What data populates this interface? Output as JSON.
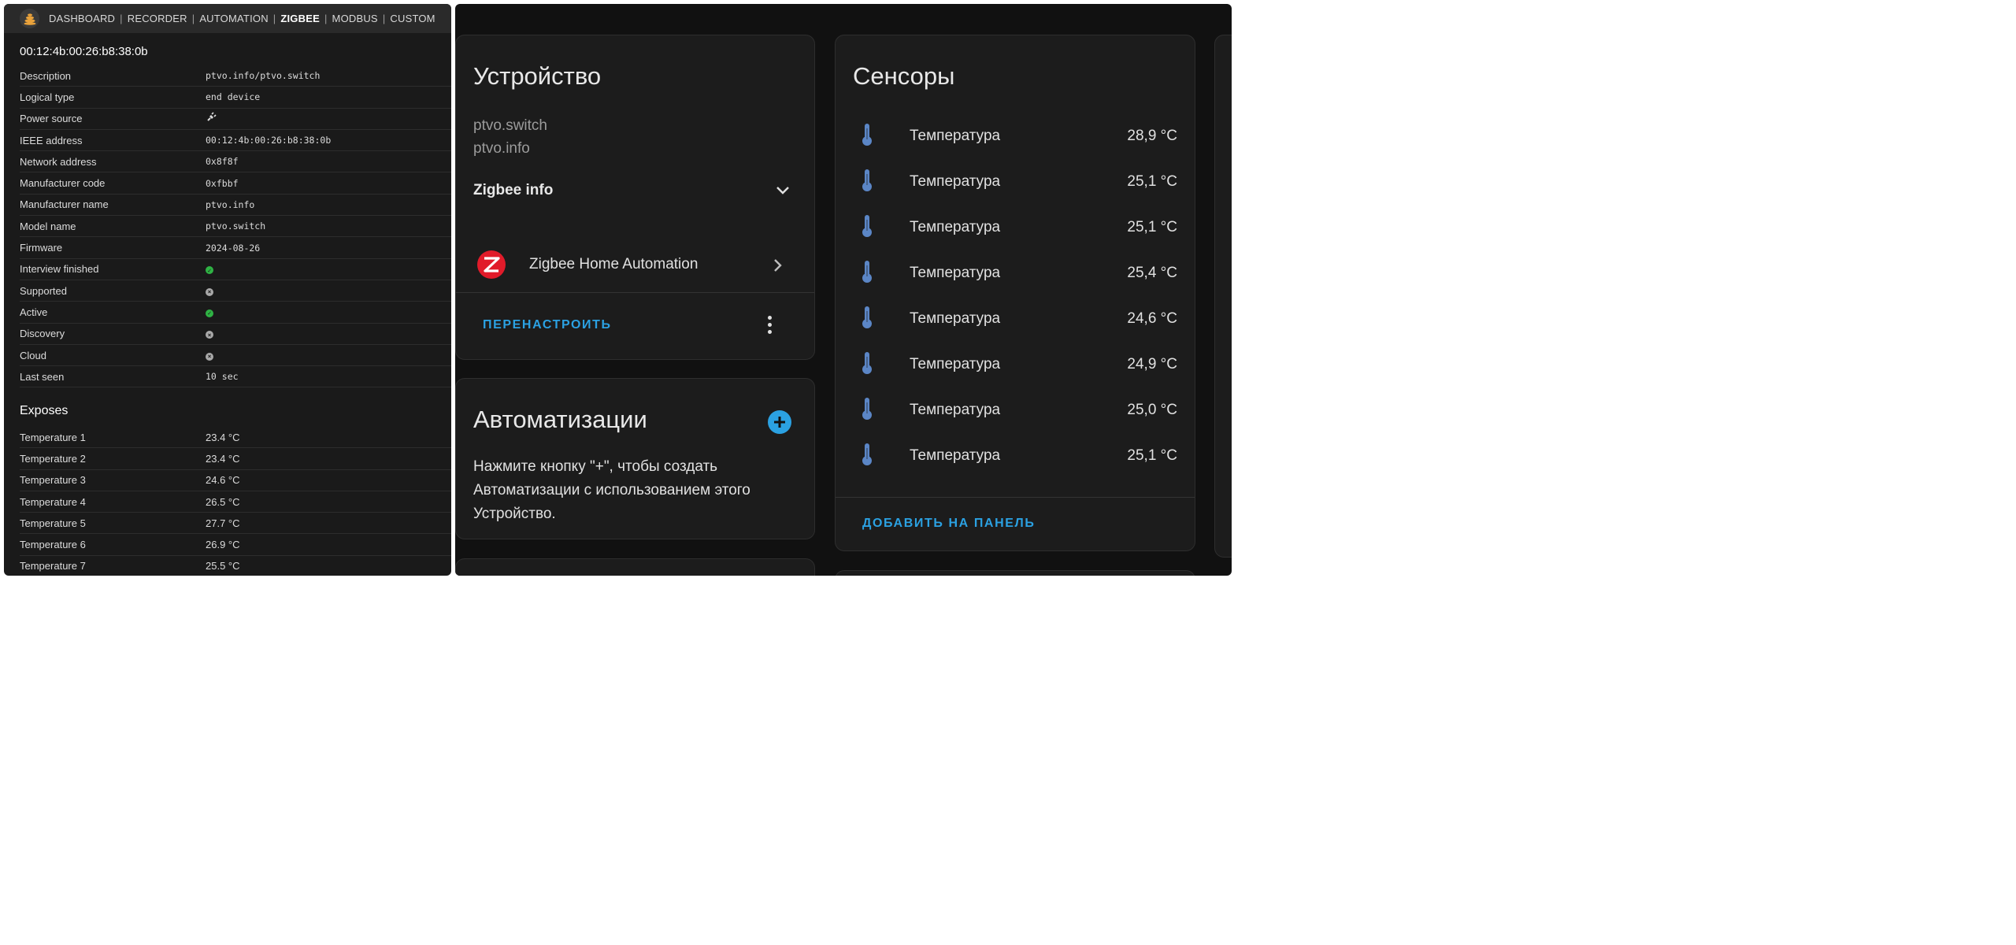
{
  "left": {
    "nav": {
      "items": [
        "DASHBOARD",
        "RECORDER",
        "AUTOMATION",
        "ZIGBEE",
        "MODBUS",
        "CUSTOM"
      ],
      "separator": "|",
      "active": "ZIGBEE"
    },
    "device_title": "00:12:4b:00:26:b8:38:0b",
    "properties": [
      {
        "key": "Description",
        "value": "ptvo.info/ptvo.switch",
        "kind": "text"
      },
      {
        "key": "Logical type",
        "value": "end device",
        "kind": "text"
      },
      {
        "key": "Power source",
        "value": "plug-icon",
        "kind": "icon"
      },
      {
        "key": "IEEE address",
        "value": "00:12:4b:00:26:b8:38:0b",
        "kind": "text"
      },
      {
        "key": "Network address",
        "value": "0x8f8f",
        "kind": "text"
      },
      {
        "key": "Manufacturer code",
        "value": "0xfbbf",
        "kind": "text"
      },
      {
        "key": "Manufacturer name",
        "value": "ptvo.info",
        "kind": "text"
      },
      {
        "key": "Model name",
        "value": "ptvo.switch",
        "kind": "text"
      },
      {
        "key": "Firmware",
        "value": "2024-08-26",
        "kind": "text"
      },
      {
        "key": "Interview finished",
        "value": "check-icon",
        "kind": "status_ok"
      },
      {
        "key": "Supported",
        "value": "cross-icon",
        "kind": "status_no"
      },
      {
        "key": "Active",
        "value": "check-icon",
        "kind": "status_ok"
      },
      {
        "key": "Discovery",
        "value": "cross-icon",
        "kind": "status_no"
      },
      {
        "key": "Cloud",
        "value": "cross-icon",
        "kind": "status_no"
      },
      {
        "key": "Last seen",
        "value": "10 sec",
        "kind": "text"
      }
    ],
    "exposes_title": "Exposes",
    "exposes": [
      {
        "key": "Temperature 1",
        "value": "23.4 °C"
      },
      {
        "key": "Temperature 2",
        "value": "23.4 °C"
      },
      {
        "key": "Temperature 3",
        "value": "24.6 °C"
      },
      {
        "key": "Temperature 4",
        "value": "26.5 °C"
      },
      {
        "key": "Temperature 5",
        "value": "27.7 °C"
      },
      {
        "key": "Temperature 6",
        "value": "26.9 °C"
      },
      {
        "key": "Temperature 7",
        "value": "25.5 °C"
      }
    ]
  },
  "right": {
    "device_card": {
      "title": "Устройство",
      "model": "ptvo.switch",
      "manufacturer": "ptvo.info",
      "zigbee_info_label": "Zigbee info",
      "integration_label": "Zigbee Home Automation",
      "reconfigure_label": "ПЕРЕНАСТРОИТЬ"
    },
    "automations_card": {
      "title": "Автоматизации",
      "help_lines": [
        "Нажмите кнопку \"+\", чтобы создать",
        "Автоматизации с использованием этого",
        "Устройство."
      ]
    },
    "sensors_card": {
      "title": "Сенсоры",
      "rows": [
        {
          "name": "Температура",
          "value": "28,9 °C"
        },
        {
          "name": "Температура",
          "value": "25,1 °C"
        },
        {
          "name": "Температура",
          "value": "25,1 °C"
        },
        {
          "name": "Температура",
          "value": "25,4 °C"
        },
        {
          "name": "Температура",
          "value": "24,6 °C"
        },
        {
          "name": "Температура",
          "value": "24,9 °C"
        },
        {
          "name": "Температура",
          "value": "25,0 °C"
        },
        {
          "name": "Температура",
          "value": "25,1 °C"
        }
      ],
      "add_to_panel_label": "ДОБАВИТЬ НА ПАНЕЛЬ"
    },
    "colors": {
      "accent": "#2ba1e2",
      "thermometer": "#5b86c6",
      "zigbee_logo": "#e11b2a",
      "status_ok": "#2fb344",
      "status_no": "#a8a8a8"
    }
  }
}
